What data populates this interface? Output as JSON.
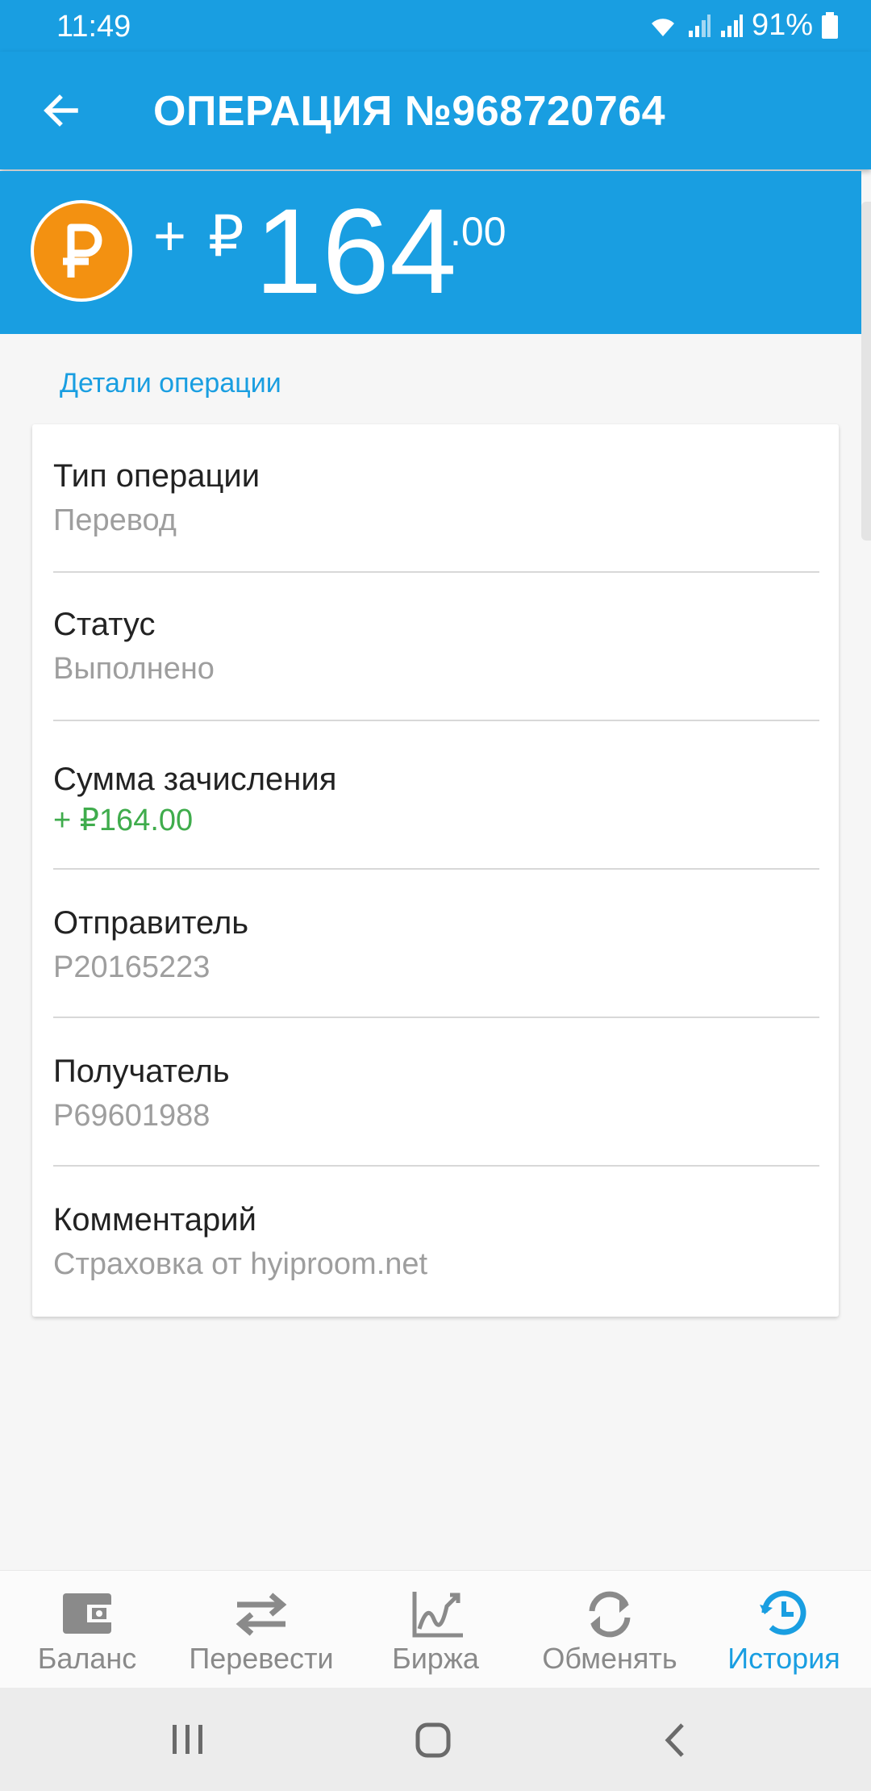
{
  "status": {
    "time": "11:49",
    "battery": "91%"
  },
  "header": {
    "title": "ОПЕРАЦИЯ №968720764"
  },
  "amount": {
    "sign": "+",
    "currency": "₽",
    "integer": "164",
    "decimal": ".00"
  },
  "details": {
    "section_title": "Детали операции",
    "rows": [
      {
        "label": "Тип операции",
        "value": "Перевод"
      },
      {
        "label": "Статус",
        "value": "Выполнено"
      },
      {
        "label": "Сумма зачисления",
        "value": "+ ₽164.00"
      },
      {
        "label": "Отправитель",
        "value": "P20165223"
      },
      {
        "label": "Получатель",
        "value": "P69601988"
      },
      {
        "label": "Комментарий",
        "value": "Страховка от hyiproom.net"
      }
    ]
  },
  "nav": {
    "items": [
      {
        "label": "Баланс",
        "icon": "wallet-icon"
      },
      {
        "label": "Перевести",
        "icon": "transfer-arrows-icon"
      },
      {
        "label": "Биржа",
        "icon": "chart-icon"
      },
      {
        "label": "Обменять",
        "icon": "refresh-icon"
      },
      {
        "label": "История",
        "icon": "history-icon"
      }
    ],
    "active": "История"
  },
  "colors": {
    "primary": "#199ee1",
    "coin": "#f39111",
    "positive": "#3fac4c"
  }
}
